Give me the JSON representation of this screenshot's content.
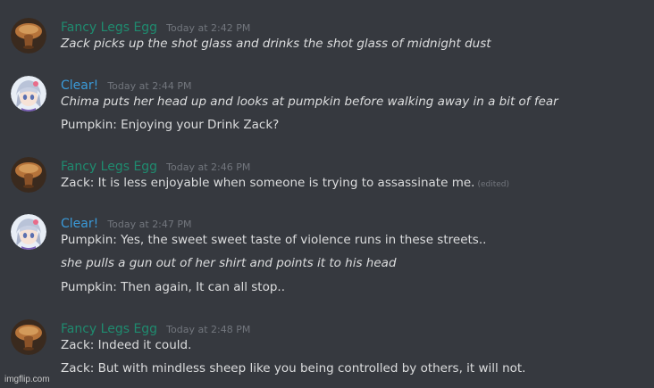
{
  "colors": {
    "background": "#36393f",
    "text": "#dcddde",
    "timestamp": "#72767d",
    "username_fancy": "#1f8b6f",
    "username_clear": "#3a9ad9"
  },
  "messages": [
    {
      "username": "Fancy Legs Egg",
      "timestamp": "Today at 2:42 PM",
      "lines": [
        {
          "text": "Zack picks up the shot glass and drinks the shot glass of midnight dust"
        }
      ]
    },
    {
      "username": "Clear!",
      "timestamp": "Today at 2:44 PM",
      "lines": [
        {
          "text": "Chima puts her head up and looks at pumpkin before walking away in a bit of fear"
        },
        {
          "text": "Pumpkin: Enjoying your Drink Zack?"
        }
      ]
    },
    {
      "username": "Fancy Legs Egg",
      "timestamp": "Today at 2:46 PM",
      "lines": [
        {
          "text": "Zack: It is less enjoyable when someone is trying to assassinate me.",
          "edited": "(edited)"
        }
      ]
    },
    {
      "username": "Clear!",
      "timestamp": "Today at 2:47 PM",
      "lines": [
        {
          "text": "Pumpkin: Yes, the sweet sweet taste of violence runs in these streets.."
        },
        {
          "text": "she pulls a gun out of her shirt and points it to his head"
        },
        {
          "text": "Pumpkin: Then again, It can all stop.."
        }
      ]
    },
    {
      "username": "Fancy Legs Egg",
      "timestamp": "Today at 2:48 PM",
      "lines": [
        {
          "text": "Zack: Indeed it could."
        },
        {
          "text": "Zack: But with mindless sheep like you being controlled by others, it will not."
        }
      ]
    }
  ],
  "watermark": "imgflip.com"
}
